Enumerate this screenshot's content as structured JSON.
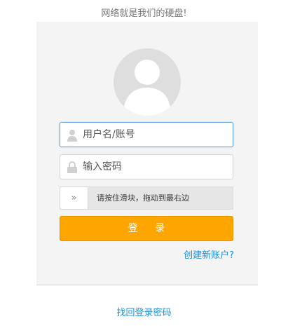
{
  "tagline": "网络就是我们的硬盘!",
  "login_form": {
    "username_placeholder": "用户名/账号",
    "password_placeholder": "输入密码",
    "slider": {
      "handle_glyph": "»",
      "instruction": "请按住滑块，拖动到最右边"
    },
    "login_button": "登 录",
    "create_account_link": "创建新账户?"
  },
  "recover_password_link": "找回登录密码",
  "colors": {
    "accent_button": "#ffa500",
    "link": "#1e90d6",
    "focus_border": "#67a4dc"
  },
  "icons": [
    "user-avatar-icon",
    "user-icon",
    "lock-icon",
    "double-chevron-right-icon"
  ]
}
